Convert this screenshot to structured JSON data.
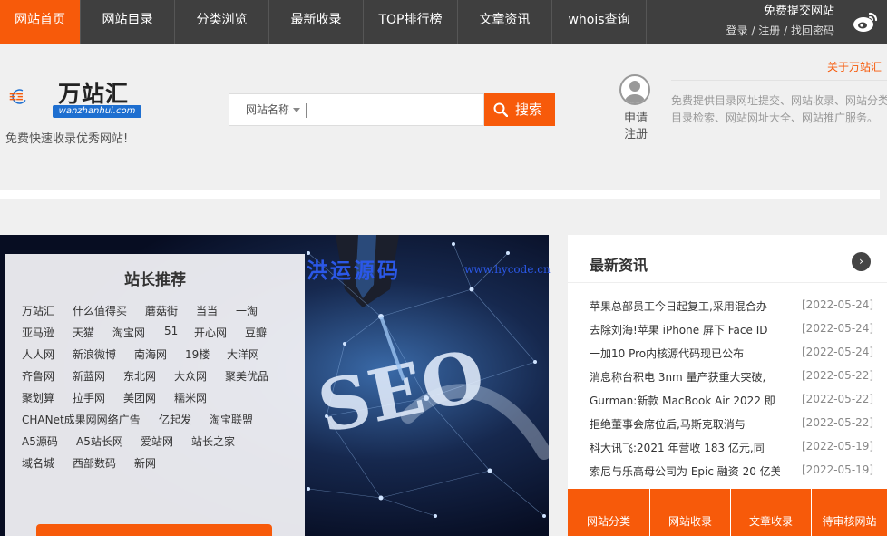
{
  "nav": {
    "items": [
      "网站首页",
      "网站目录",
      "分类浏览",
      "最新收录",
      "TOP排行榜",
      "文章资讯",
      "whois查询"
    ],
    "submit_label": "免费提交网站",
    "login": "登录",
    "register": "注册",
    "forgot": "找回密码",
    "sep": " / "
  },
  "header": {
    "logo_text": "万站汇",
    "logo_domain": "wanzhanhui.com",
    "slogan": "免费快速收录优秀网站!",
    "search_option": "网站名称",
    "search_value": "",
    "search_button": "搜索",
    "register_line1": "申请",
    "register_line2": "注册",
    "about_title": "关于万站汇",
    "about_desc_line1": "免费提供目录网址提交、网站收录、网站分类",
    "about_desc_line2": "目录检索、网站网址大全、网站推广服务。"
  },
  "banner": {
    "watermark_cn": "洪运源码",
    "watermark_url": "www.hycode.cn"
  },
  "recommend": {
    "title": "站长推荐",
    "rows": [
      [
        "万站汇",
        "什么值得买",
        "蘑菇街",
        "当当",
        "一淘"
      ],
      [
        "亚马逊",
        "天猫",
        "淘宝网",
        "51",
        "开心网",
        "豆瓣"
      ],
      [
        "人人网",
        "新浪微博",
        "南海网",
        "19楼",
        "大洋网"
      ],
      [
        "齐鲁网",
        "新蓝网",
        "东北网",
        "大众网",
        "聚美优品"
      ],
      [
        "聚划算",
        "拉手网",
        "美团网",
        "糯米网"
      ],
      [
        "CHANet成果网网络广告",
        "亿起发",
        "淘宝联盟"
      ],
      [
        "A5源码",
        "A5站长网",
        "爱站网",
        "站长之家"
      ],
      [
        "域名城",
        "西部数码",
        "新网"
      ]
    ]
  },
  "news": {
    "title": "最新资讯",
    "arrow": "›",
    "items": [
      {
        "title": "苹果总部员工今日起复工,采用混合办",
        "date": "[2022-05-24]"
      },
      {
        "title": "去除刘海!苹果 iPhone 屏下 Face ID",
        "date": "[2022-05-24]"
      },
      {
        "title": "一加10 Pro内核源代码现已公布",
        "date": "[2022-05-24]"
      },
      {
        "title": "消息称台积电 3nm 量产获重大突破,",
        "date": "[2022-05-22]"
      },
      {
        "title": "Gurman:新款 MacBook Air 2022 即",
        "date": "[2022-05-22]"
      },
      {
        "title": "拒绝董事会席位后,马斯克取消与",
        "date": "[2022-05-22]"
      },
      {
        "title": "科大讯飞:2021 年营收 183 亿元,同",
        "date": "[2022-05-19]"
      },
      {
        "title": "索尼与乐高母公司为 Epic 融资 20 亿美",
        "date": "[2022-05-19]"
      }
    ]
  },
  "tabs": [
    "网站分类",
    "网站收录",
    "文章收录",
    "待审核网站"
  ],
  "colors": {
    "accent": "#f75a0a",
    "nav_bg": "#3f3f3f",
    "logo_blue": "#1e6fd0"
  }
}
